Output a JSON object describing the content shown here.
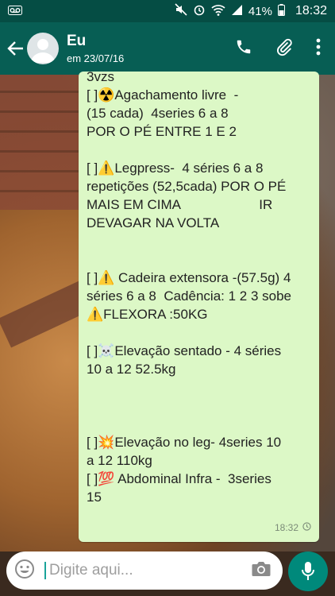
{
  "status_bar": {
    "battery": "41%",
    "time": "18:32"
  },
  "header": {
    "contact_name": "Eu",
    "last_seen": "em 23/07/16"
  },
  "message": {
    "text_lines": [
      "3vzs",
      "[ ]☢️Agachamento livre  -",
      "(15 cada)  4series 6 a 8",
      "POR O PÉ ENTRE 1 E 2",
      "",
      "[ ]⚠️Legpress-  4 séries 6 a 8",
      "repetições (52,5cada) POR O PÉ",
      "MAIS EM CIMA                     IR",
      "DEVAGAR NA VOLTA",
      "",
      "",
      "[ ]⚠️ Cadeira extensora -(57.5g) 4",
      "séries 6 a 8  Cadência: 1 2 3 sobe",
      "⚠️FLEXORA :50KG",
      "",
      "[ ]☠️Elevação sentado - 4 séries",
      "10 a 12 52.5kg",
      "",
      "",
      "",
      "[ ]💥Elevação no leg- 4series 10",
      "a 12 110kg",
      "[ ]💯 Abdominal Infra -  3series",
      "15"
    ],
    "time": "18:32"
  },
  "composer": {
    "placeholder": "Digite aqui..."
  },
  "colors": {
    "header": "#075e54",
    "status_bar": "#054d44",
    "bubble": "#dcf8c6",
    "mic_button": "#00897b"
  }
}
